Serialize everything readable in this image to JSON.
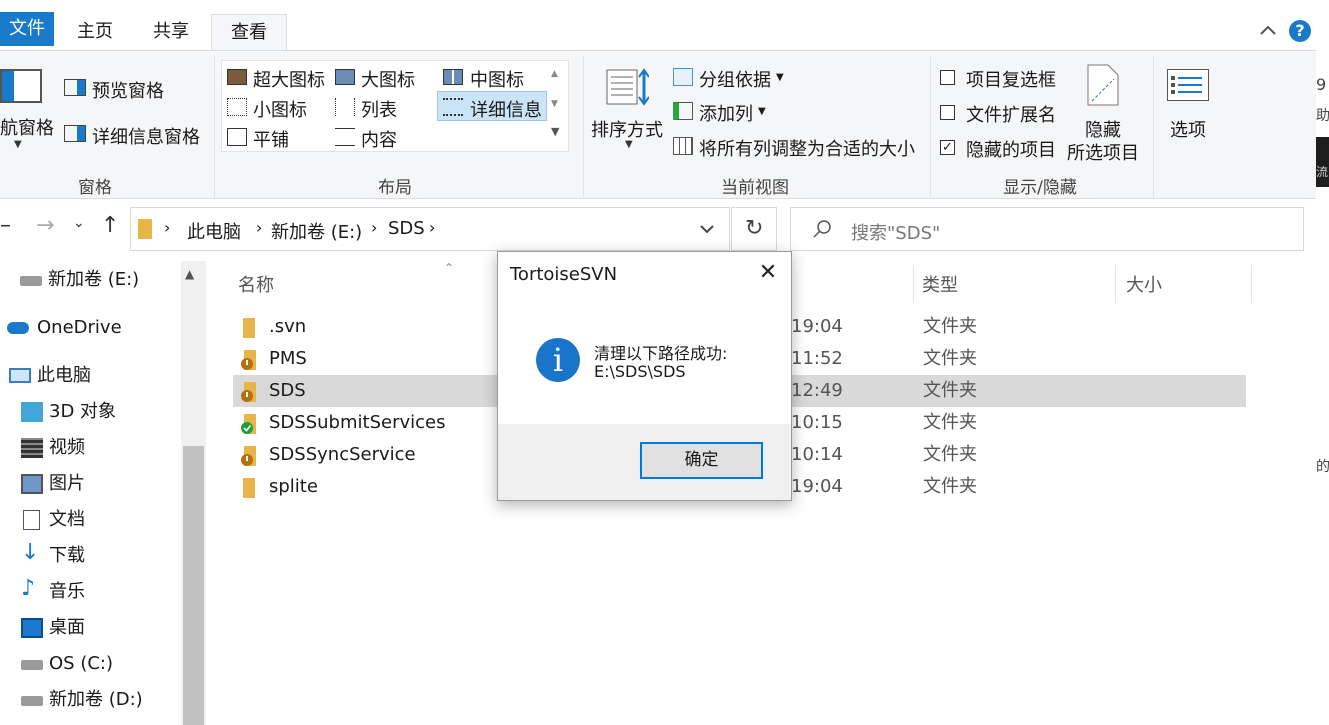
{
  "tabs": {
    "file": "文件",
    "home": "主页",
    "share": "共享",
    "view": "查看"
  },
  "ribbon": {
    "panes": {
      "nav_pane": "航窗格",
      "preview_pane": "预览窗格",
      "details_pane": "详细信息窗格",
      "group_label": "窗格"
    },
    "layout": {
      "extra_large": "超大图标",
      "large": "大图标",
      "medium": "中图标",
      "small": "小图标",
      "list": "列表",
      "details": "详细信息",
      "tiles": "平铺",
      "content": "内容",
      "group_label": "布局"
    },
    "current_view": {
      "sort_by": "排序方式",
      "group_by": "分组依据",
      "add_columns": "添加列",
      "size_all_columns": "将所有列调整为合适的大小",
      "group_label": "当前视图"
    },
    "show_hide": {
      "item_check_boxes": "项目复选框",
      "file_name_extensions": "文件扩展名",
      "hidden_items": "隐藏的项目",
      "hide_selected_line1": "隐藏",
      "hide_selected_line2": "所选项目",
      "group_label": "显示/隐藏",
      "hidden_items_checked": "✓"
    },
    "options": "选项"
  },
  "address": {
    "crumbs": [
      "此电脑",
      "新加卷 (E:)",
      "SDS"
    ],
    "search_placeholder": "搜索\"SDS\""
  },
  "nav": {
    "items": [
      "新加卷 (E:)",
      "OneDrive",
      "此电脑",
      "3D 对象",
      "视频",
      "图片",
      "文档",
      "下载",
      "音乐",
      "桌面",
      "OS (C:)",
      "新加卷 (D:)"
    ]
  },
  "list": {
    "headers": {
      "name": "名称",
      "type": "类型",
      "size": "大小"
    },
    "rows": [
      {
        "name": ".svn",
        "time": "19:04",
        "type": "文件夹"
      },
      {
        "name": "PMS",
        "time": "11:52",
        "type": "文件夹"
      },
      {
        "name": "SDS",
        "time": "12:49",
        "type": "文件夹"
      },
      {
        "name": "SDSSubmitServices",
        "time": "10:15",
        "type": "文件夹"
      },
      {
        "name": "SDSSyncService",
        "time": "10:14",
        "type": "文件夹"
      },
      {
        "name": "splite",
        "time": "19:04",
        "type": "文件夹"
      }
    ]
  },
  "edge": {
    "t1": "9",
    "t2": "助",
    "t3": "流",
    "t4": "的"
  },
  "dialog": {
    "title": "TortoiseSVN",
    "close": "✕",
    "icon_glyph": "i",
    "message_line1": "清理以下路径成功:",
    "message_line2": "E:\\SDS\\SDS",
    "ok": "确定"
  },
  "colors": {
    "accent": "#1979ca",
    "selected_row": "#d9d9d9",
    "svn_ok": "#1e9e3e",
    "svn_modified": "#b5700e"
  }
}
